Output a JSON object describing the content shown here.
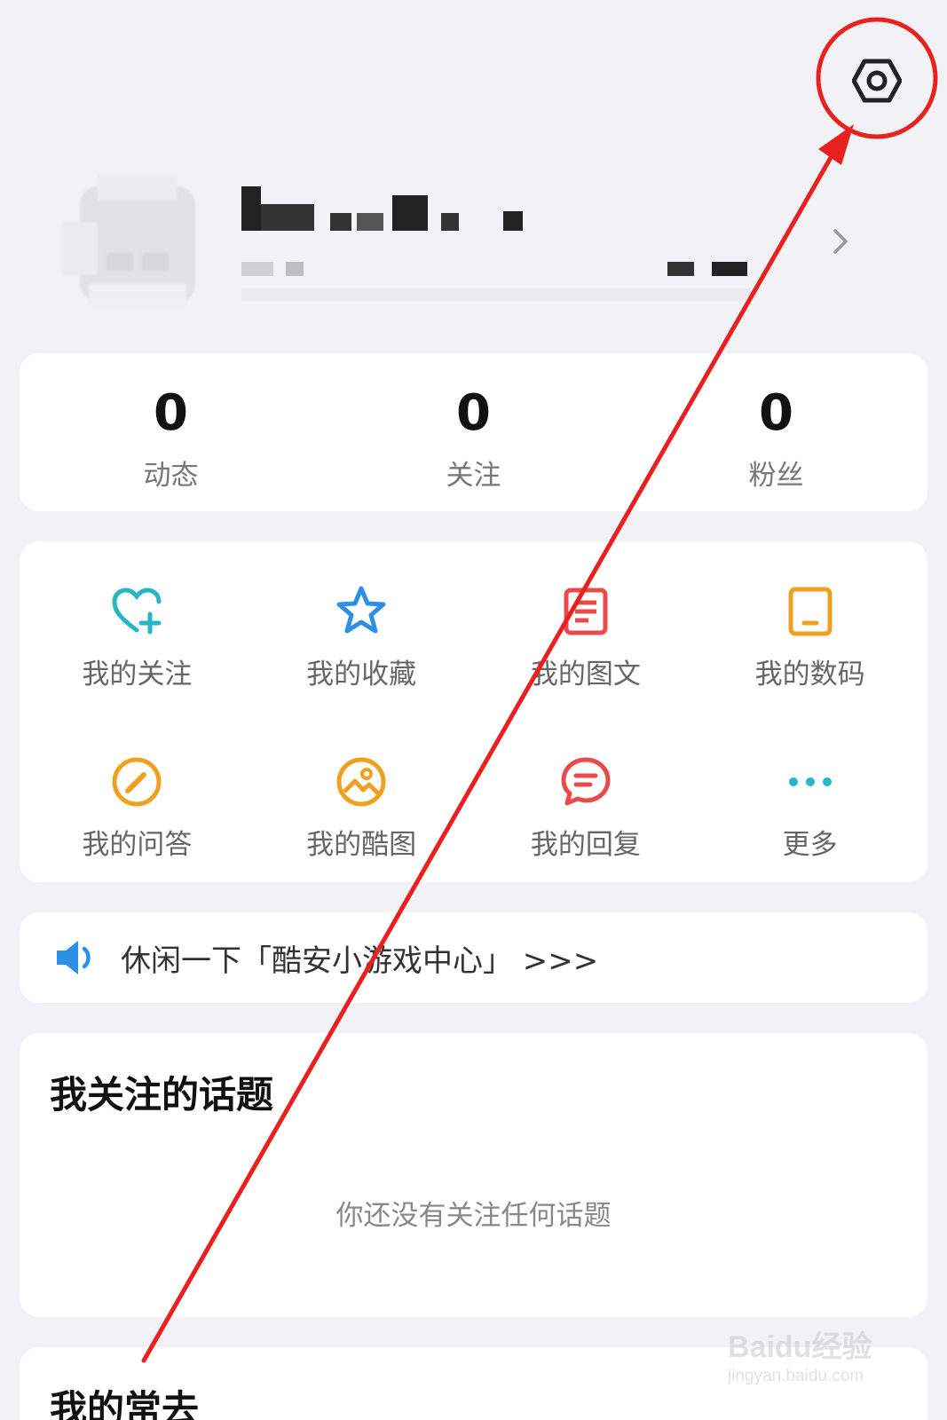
{
  "header": {
    "settings_icon": "settings-hexagon-icon"
  },
  "profile": {
    "chevron_icon": "chevron-right-icon"
  },
  "stats": [
    {
      "value": "0",
      "label": "动态"
    },
    {
      "value": "0",
      "label": "关注"
    },
    {
      "value": "0",
      "label": "粉丝"
    }
  ],
  "grid": [
    {
      "label": "我的关注",
      "icon": "heart-plus-icon",
      "color": "#26b6c4"
    },
    {
      "label": "我的收藏",
      "icon": "star-icon",
      "color": "#2e8fe6"
    },
    {
      "label": "我的图文",
      "icon": "article-icon",
      "color": "#e94b4b"
    },
    {
      "label": "我的数码",
      "icon": "tablet-icon",
      "color": "#f0a020"
    },
    {
      "label": "我的问答",
      "icon": "pencil-circle-icon",
      "color": "#f0a020"
    },
    {
      "label": "我的酷图",
      "icon": "image-circle-icon",
      "color": "#f0a020"
    },
    {
      "label": "我的回复",
      "icon": "comment-icon",
      "color": "#e94b4b"
    },
    {
      "label": "更多",
      "icon": "more-dots-icon",
      "color": "#26b6c4"
    }
  ],
  "banner": {
    "text": "休闲一下「酷安小游戏中心」 >>>",
    "icon": "speaker-icon",
    "icon_color": "#2e8fe6"
  },
  "topics": {
    "title": "我关注的话题",
    "empty_text": "你还没有关注任何话题"
  },
  "frequent": {
    "title": "我的常去"
  },
  "annotation": {
    "color": "#e8211f"
  },
  "watermark": {
    "brand": "Baidu经验",
    "url": "jingyan.baidu.com"
  }
}
